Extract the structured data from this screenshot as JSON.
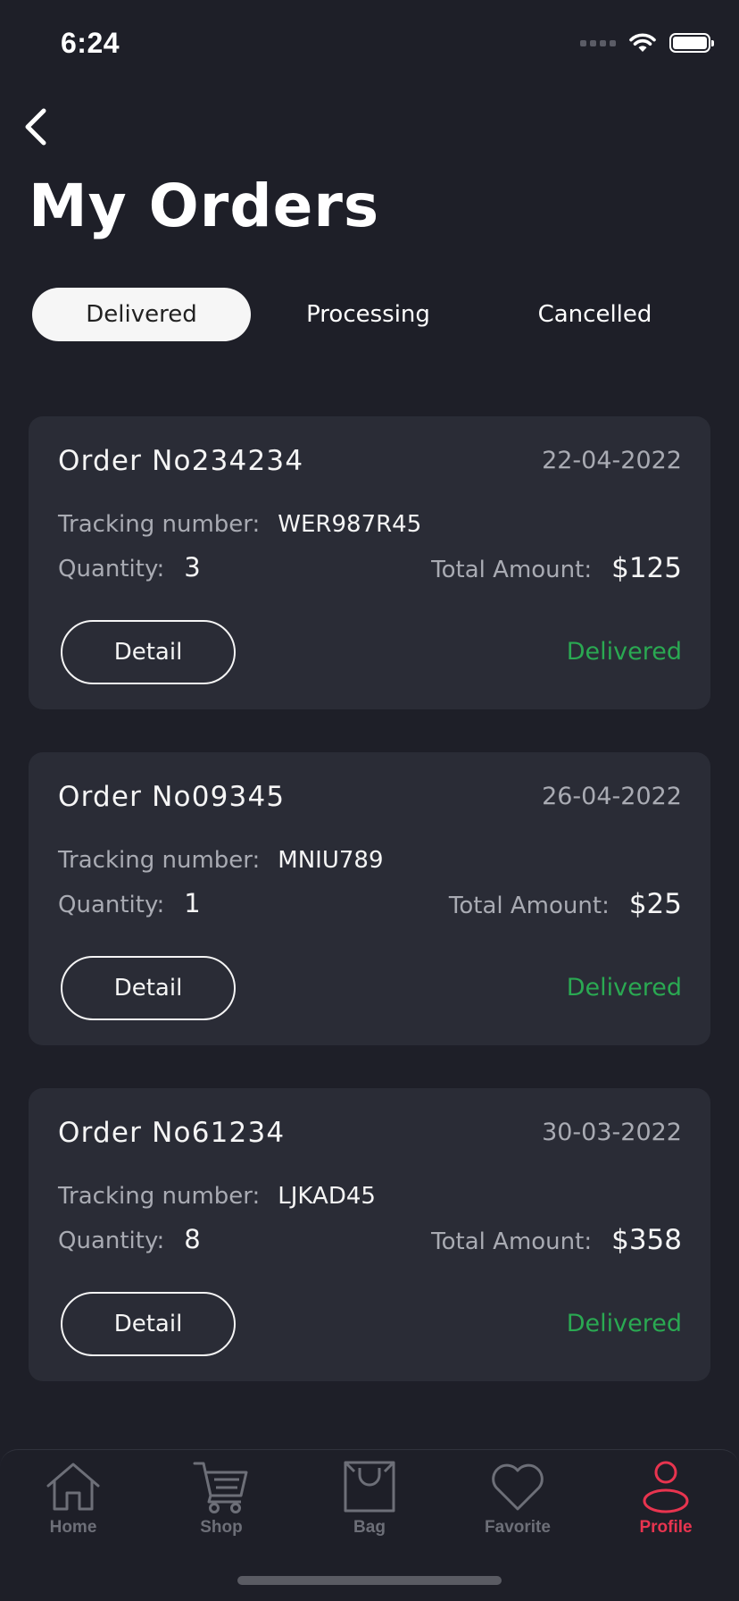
{
  "status_bar": {
    "time": "6:24"
  },
  "header": {
    "title": "My Orders"
  },
  "tabs": [
    {
      "label": "Delivered",
      "active": true
    },
    {
      "label": "Processing",
      "active": false
    },
    {
      "label": "Cancelled",
      "active": false
    }
  ],
  "labels": {
    "tracking": "Tracking number:",
    "quantity": "Quantity:",
    "total": "Total Amount:",
    "detail": "Detail"
  },
  "orders": [
    {
      "number": "Order No234234",
      "date": "22-04-2022",
      "tracking": "WER987R45",
      "quantity": "3",
      "total": "$125",
      "status": "Delivered"
    },
    {
      "number": "Order No09345",
      "date": "26-04-2022",
      "tracking": "MNIU789",
      "quantity": "1",
      "total": "$25",
      "status": "Delivered"
    },
    {
      "number": "Order No61234",
      "date": "30-03-2022",
      "tracking": "LJKAD45",
      "quantity": "8",
      "total": "$358",
      "status": "Delivered"
    }
  ],
  "bottom_nav": [
    {
      "label": "Home",
      "icon": "home-icon",
      "active": false
    },
    {
      "label": "Shop",
      "icon": "cart-icon",
      "active": false
    },
    {
      "label": "Bag",
      "icon": "bag-icon",
      "active": false
    },
    {
      "label": "Favorite",
      "icon": "heart-icon",
      "active": false
    },
    {
      "label": "Profile",
      "icon": "profile-icon",
      "active": true
    }
  ],
  "colors": {
    "background": "#1e1f28",
    "card": "#2a2c36",
    "delivered": "#2aa952",
    "accent": "#e8344f",
    "muted": "#a9abb3"
  }
}
